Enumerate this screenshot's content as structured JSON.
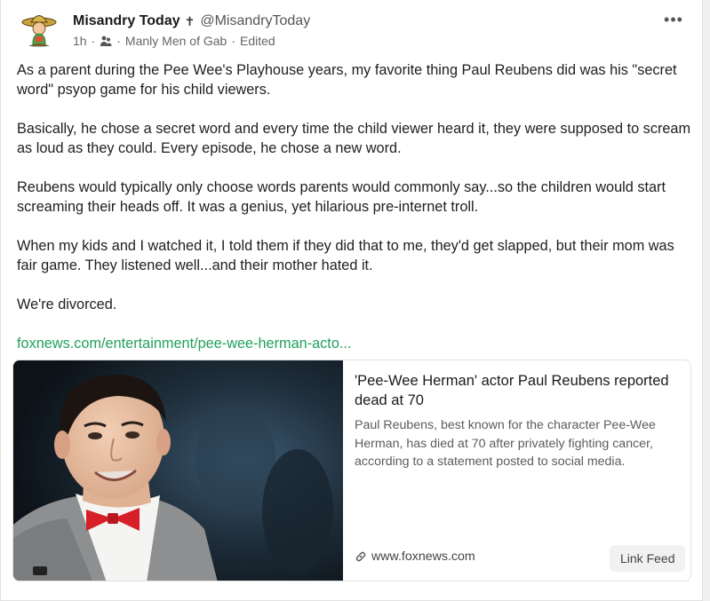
{
  "post": {
    "author": {
      "display_name": "Misandry Today",
      "badge": "✝",
      "handle": "@MisandryToday"
    },
    "meta": {
      "time": "1h",
      "group": "Manly Men of Gab",
      "edited": "Edited"
    },
    "paragraphs": [
      "As a parent during the Pee Wee's Playhouse years, my favorite thing Paul Reubens did was his \"secret word\" psyop game for his child viewers.",
      "Basically, he chose a secret word and every time the child viewer heard it, they were supposed to scream as loud as they could. Every episode, he chose a new word.",
      "Reubens would typically only choose words parents would commonly say...so the children would start screaming their heads off. It was a genius, yet hilarious pre-internet troll.",
      "When my kids and I watched it, I told them if they did that to me, they'd get slapped, but their mom was fair game. They listened well...and their mother hated it.",
      "We're divorced."
    ],
    "link_text": "foxnews.com/entertainment/pee-wee-herman-acto...",
    "more_label": "•••"
  },
  "preview": {
    "title": "'Pee-Wee Herman' actor Paul Reubens reported dead at 70",
    "description": "Paul Reubens, best known for the character Pee-Wee Herman, has died at 70 after privately fighting cancer, according to a statement posted to social media.",
    "domain": "www.foxnews.com",
    "link_feed_label": "Link Feed"
  },
  "colors": {
    "link": "#21a15b",
    "card_border": "#e2e2e2",
    "muted": "#666666"
  },
  "icons": {
    "avatar": "cartoon-sombrero-avatar",
    "group": "group-icon",
    "more": "more-options-icon",
    "chain": "link-chain-icon"
  }
}
